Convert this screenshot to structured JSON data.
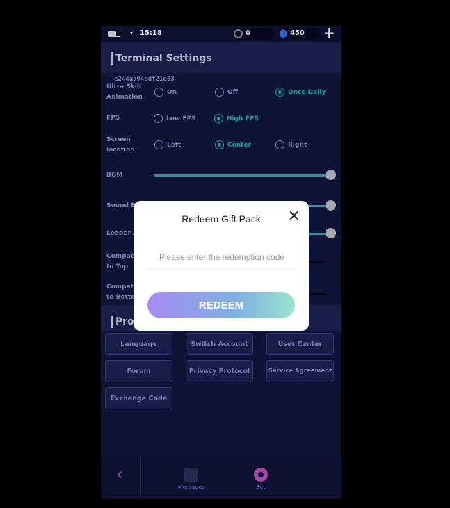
{
  "status_bar": {
    "time": "15:18",
    "coins": "0",
    "gems": "450"
  },
  "header": {
    "title": "Terminal Settings",
    "device_id": "e244ad94bdf21e33"
  },
  "settings": {
    "ultra_skill": {
      "label": "Ultra Skill Animation",
      "options": [
        "On",
        "Off",
        "Once Daily"
      ],
      "selected": "Once Daily"
    },
    "fps": {
      "label": "FPS",
      "options": [
        "Low FPS",
        "High FPS"
      ],
      "selected": "High FPS"
    },
    "screen_location": {
      "label": "Screen location",
      "options": [
        "Left",
        "Center",
        "Right"
      ],
      "selected": "Center"
    },
    "bgm": {
      "label": "BGM",
      "value": 1.0
    },
    "sound": {
      "label": "Sound E",
      "value": 1.0
    },
    "leaper": {
      "label": "Leaper A",
      "value": 1.0
    },
    "compat_top": {
      "label": "Compati to Top",
      "value": 0
    },
    "compat_bottom": {
      "label": "Compati to Botto",
      "value": 0
    }
  },
  "section2": {
    "title": "Pro"
  },
  "buttons": [
    "Language",
    "Switch Account",
    "User Center",
    "Forum",
    "Privacy Protocol",
    "Service Agreement",
    "Exchange Code"
  ],
  "nav": {
    "messages": "Messages",
    "set": "Set"
  },
  "modal": {
    "title": "Redeem Gift Pack",
    "placeholder": "Please enter the redemption code",
    "button": "REDEEM"
  },
  "colors": {
    "accent": "#1fb8a8",
    "background": "#12163d"
  }
}
